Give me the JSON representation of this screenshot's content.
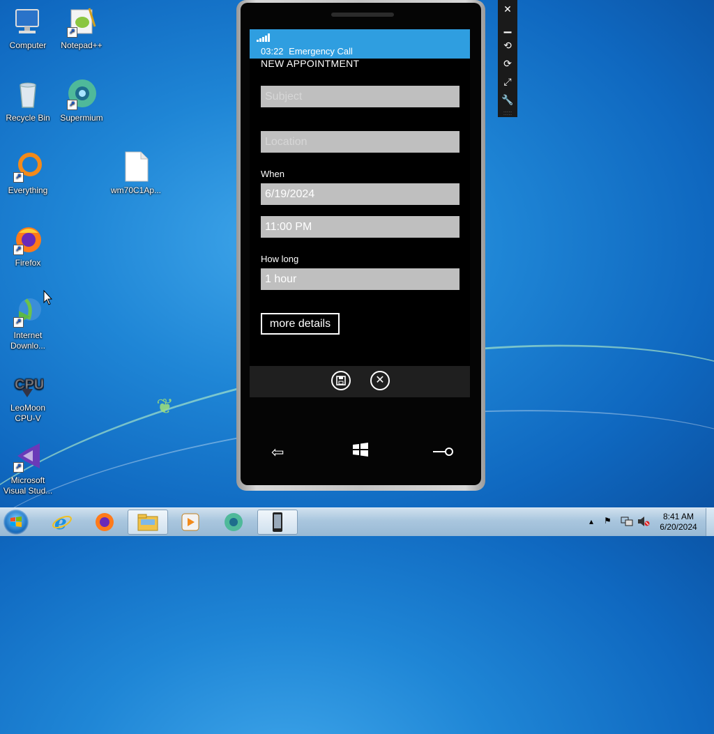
{
  "desktop": {
    "icons": [
      {
        "label": "Computer"
      },
      {
        "label": "Notepad++"
      },
      {
        "label": "Recycle Bin"
      },
      {
        "label": "Supermium"
      },
      {
        "label": "Everything"
      },
      {
        "label": "wm70C1Ap..."
      },
      {
        "label": "Firefox"
      },
      {
        "label": "Internet Downlo..."
      },
      {
        "label": "LeoMoon CPU-V"
      },
      {
        "label": "Microsoft Visual Stud..."
      }
    ]
  },
  "phone": {
    "status": {
      "time": "03:22",
      "network": "Emergency Call"
    },
    "page_title": "NEW APPOINTMENT",
    "subject": {
      "placeholder": "Subject",
      "value": ""
    },
    "location": {
      "placeholder": "Location",
      "value": ""
    },
    "when_label": "When",
    "date_value": "6/19/2024",
    "time_value": "11:00 PM",
    "howlong_label": "How long",
    "duration_value": "1 hour",
    "more_details_label": "more details",
    "appbar": {
      "save_icon": "save-icon",
      "cancel_icon": "close-icon"
    },
    "hardware": {
      "back_icon": "back-arrow-icon",
      "start_icon": "windows-logo-icon",
      "search_icon": "search-icon"
    }
  },
  "emulator_toolbar": [
    "close-icon",
    "minimize-icon",
    "rotate-left-icon",
    "rotate-right-icon",
    "fit-screen-icon",
    "tools-icon"
  ],
  "taskbar": {
    "items": [
      "internet-explorer-icon",
      "firefox-icon",
      "file-explorer-icon",
      "media-player-icon",
      "supermium-icon",
      "phone-emulator-icon"
    ],
    "clock": {
      "time": "8:41 AM",
      "date": "6/20/2024"
    }
  },
  "colors": {
    "accent": "#2f9ee0",
    "field_bg": "#bfbfbf",
    "appbar_bg": "#1f1f1f"
  }
}
